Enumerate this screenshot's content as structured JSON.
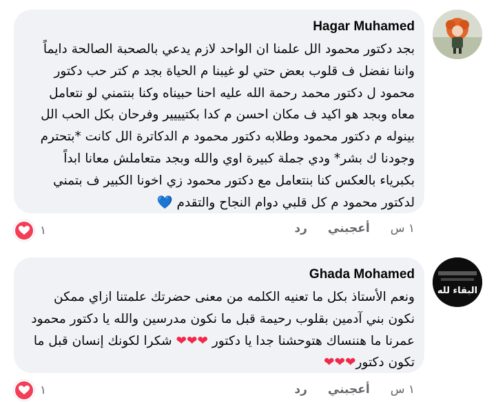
{
  "comments": [
    {
      "author": "Hagar Muhamed",
      "text": "بجد دكتور محمود الل علمنا ان الواحد لازم يدعي بالصحبة الصالحة دايماً واننا نفضل ف قلوب بعض حتي لو غيبنا م الحياة بجد م كتر حب دكتور محمود ل دكتور محمد رحمة الله عليه احنا حبيناه وكنا بنتمني لو نتعامل معاه وبجد هو اكيد ف مكان احسن م كدا بكتيييير وفرحان بكل الحب الل بينوله م دكتور محمود وطلابه دكتور محمود م الدكاترة الل كانت *بتحترم وجودنا ك بشر* ودي جملة كبيرة اوي والله وبجد متعاملش معانا ابداً بكبرياء بالعكس كنا بنتعامل مع دكتور محمود زي اخونا الكبير  ف بتمني لدكتور محمود م كل قلبي دوام النجاح والتقدم",
      "emoji": "💙",
      "time": "١ س",
      "like_label": "أعجبني",
      "reply_label": "رد",
      "reaction_count": "١"
    },
    {
      "author": "Ghada Mohamed",
      "text_part1": "ونعم الأستاذ بكل ما تعنيه الكلمه من معنى حضرتك علمتنا ازاي ممكن نكون بني آدمين بقلوب رحيمة قبل ما نكون مدرسين والله يا دكتور محمود عمرنا ما هننساك هتوحشنا جدا يا دكتور",
      "hearts1": "❤❤❤",
      "text_part2": " شكرا لكونك إنسان قبل ما تكون دكتور",
      "hearts2": "❤❤❤",
      "time": "١ س",
      "like_label": "أعجبني",
      "reply_label": "رد",
      "reaction_count": "١",
      "avatar_text": "البقاء لله"
    }
  ],
  "colors": {
    "bubble": "#f0f2f5",
    "meta": "#65676b",
    "love_reaction": "#f33e58"
  },
  "icons": {
    "reaction": "love-reaction-icon"
  }
}
